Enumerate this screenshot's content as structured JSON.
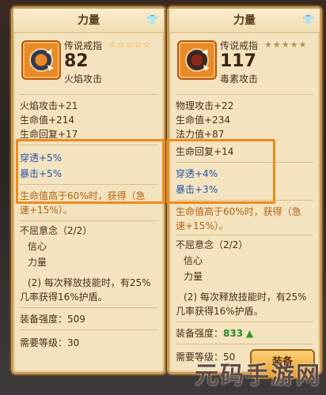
{
  "left": {
    "header": "力量",
    "item_name": "传说戒指",
    "stars": "☆☆☆☆☆",
    "power": "82",
    "subtype": "火焰攻击",
    "stats": [
      "火焰攻击+21",
      "生命值+214",
      "生命回复+17"
    ],
    "highlight_stats": [
      "穿透+5%",
      "暴击+5%"
    ],
    "special_line1": "生命值高于60%时，获得（急",
    "special_line2": "速+15%）。",
    "set_title": "不屈意念（2/2）",
    "set_items": [
      "信心",
      "力量"
    ],
    "skill_line1": "(2) 每次释放技能时，有25%",
    "skill_line2": "几率获得16%护盾。",
    "strength_label": "装备强度：509",
    "level_label": "需要等级：30"
  },
  "right": {
    "header": "力量",
    "item_name": "传说戒指",
    "stars": "★★★★★",
    "power": "117",
    "subtype": "毒素攻击",
    "stats": [
      "物理攻击+22",
      "生命值+234",
      "法力值+87",
      "生命回复+14"
    ],
    "highlight_stats": [
      "穿透+4%",
      "暴击+3%"
    ],
    "special_line1": "生命值高于60%时，获得（急",
    "special_line2": "速+15%）。",
    "set_title": "不屈意念（2/2）",
    "set_items": [
      "信心",
      "力量"
    ],
    "skill_line1": "(2) 每次释放技能时，有25%",
    "skill_line2": "几率获得16%护盾。",
    "strength_label": "装备强度：",
    "strength_value": "833",
    "level_label": "需要等级：50"
  },
  "equip_button": "装备",
  "watermark": "元码手游网",
  "colors": {
    "highlight": "#f08a1a",
    "card_bg": "#f3e3bf",
    "blue_stat": "#2754a8"
  }
}
